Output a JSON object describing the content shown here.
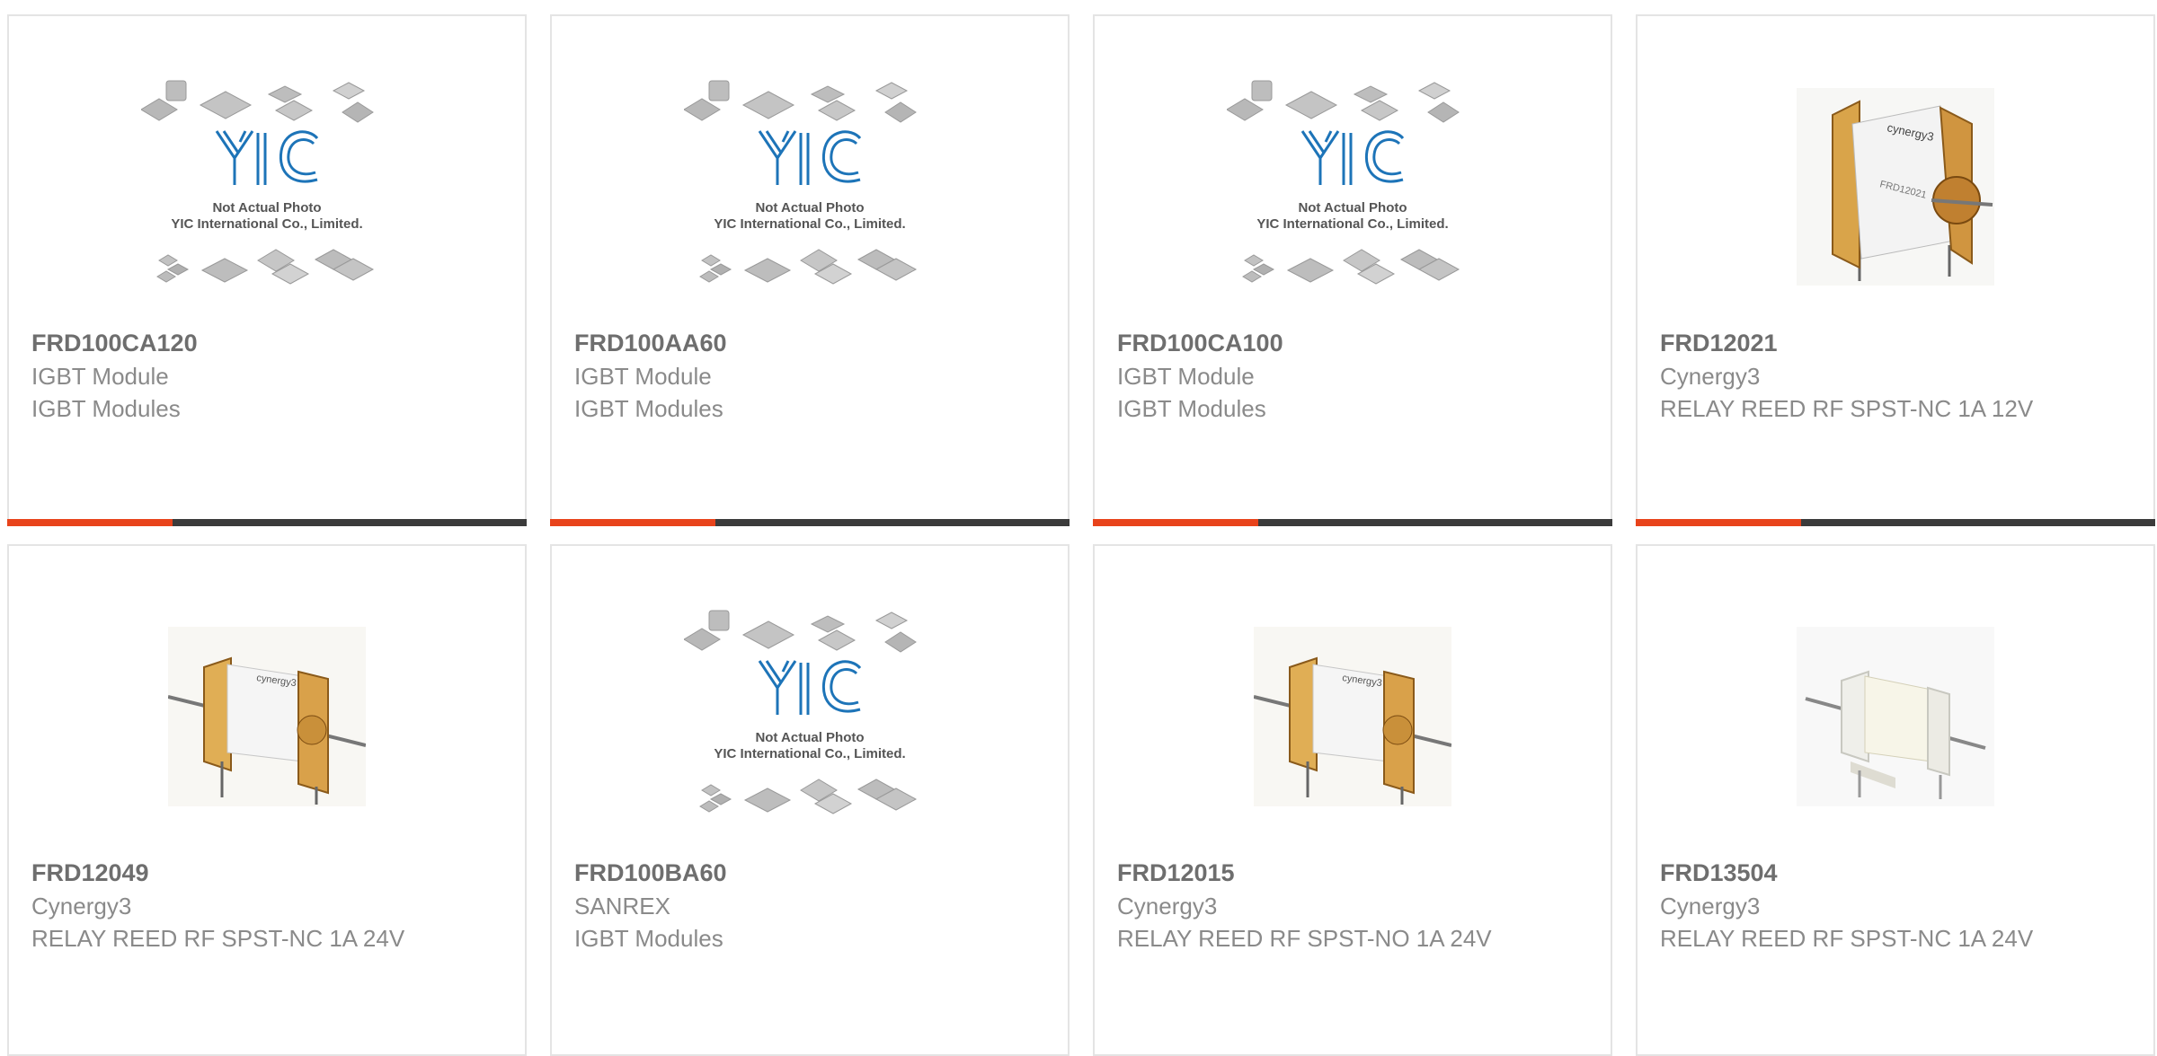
{
  "placeholder": {
    "line1": "Not Actual Photo",
    "line2": "YIC International Co., Limited.",
    "logo": "YIC"
  },
  "relay_label": "cynergy3",
  "relay_part_label": "FRD12021",
  "colors": {
    "accent": "#e8431b",
    "bar": "#3b3b3b",
    "border": "#e4e4e4",
    "text": "#8a8a8a",
    "part": "#6e6e6e",
    "logo": "#1d74b8"
  },
  "products": [
    {
      "part": "FRD100CA120",
      "brand": "IGBT Module",
      "desc": "IGBT Modules",
      "image": "yic-placeholder"
    },
    {
      "part": "FRD100AA60",
      "brand": "IGBT Module",
      "desc": "IGBT Modules",
      "image": "yic-placeholder"
    },
    {
      "part": "FRD100CA100",
      "brand": "IGBT Module",
      "desc": "IGBT Modules",
      "image": "yic-placeholder"
    },
    {
      "part": "FRD12021",
      "brand": "Cynergy3",
      "desc": "RELAY REED RF SPST-NC 1A 12V",
      "image": "relay-vertical"
    },
    {
      "part": "FRD12049",
      "brand": "Cynergy3",
      "desc": "RELAY REED RF SPST-NC 1A 24V",
      "image": "relay-horizontal"
    },
    {
      "part": "FRD100BA60",
      "brand": "SANREX",
      "desc": "IGBT Modules",
      "image": "yic-placeholder"
    },
    {
      "part": "FRD12015",
      "brand": "Cynergy3",
      "desc": "RELAY REED RF SPST-NO 1A 24V",
      "image": "relay-horizontal"
    },
    {
      "part": "FRD13504",
      "brand": "Cynergy3",
      "desc": "RELAY REED RF SPST-NC 1A 24V",
      "image": "relay-white"
    }
  ]
}
